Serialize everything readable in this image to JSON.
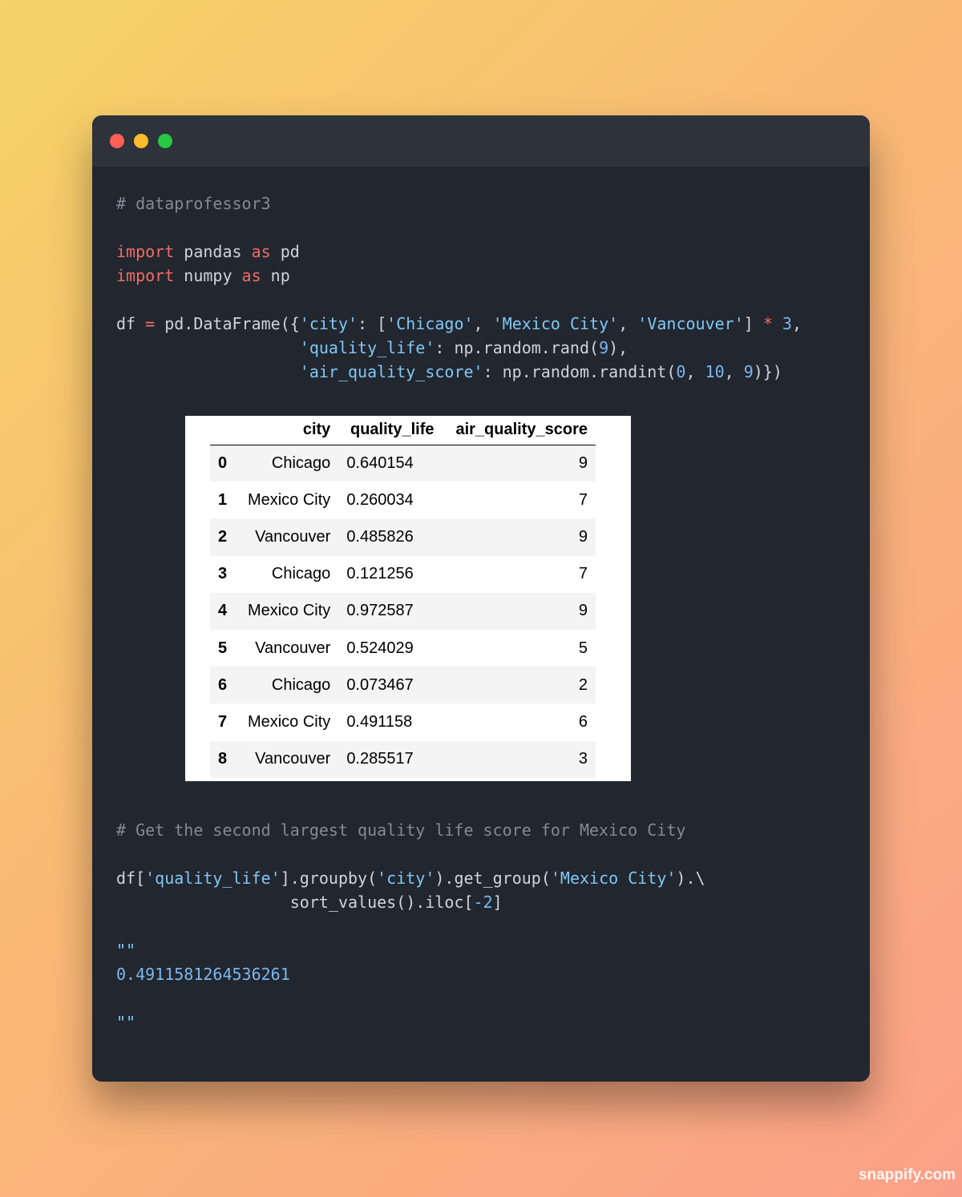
{
  "window": {
    "traffic_lights": [
      "close",
      "minimize",
      "maximize"
    ]
  },
  "code_lines": {
    "comment1": "# dataprofessor3",
    "import1": {
      "kw": "import",
      "mod": " pandas ",
      "as": "as",
      "alias": " pd"
    },
    "import2": {
      "kw": "import",
      "mod": " numpy ",
      "as": "as",
      "alias": " np"
    },
    "df_line1": {
      "a": "df ",
      "eq": "=",
      "b": " pd.DataFrame({",
      "s1": "'city'",
      "c": ": [",
      "s2": "'Chicago'",
      "d": ", ",
      "s3": "'Mexico City'",
      "e": ", ",
      "s4": "'Vancouver'",
      "f": "] ",
      "star": "*",
      "g": " ",
      "n3": "3",
      "h": ","
    },
    "df_line2": {
      "pad": "                   ",
      "s": "'quality_life'",
      "a": ": np.random.rand(",
      "n": "9",
      "b": "),"
    },
    "df_line3": {
      "pad": "                   ",
      "s": "'air_quality_score'",
      "a": ": np.random.randint(",
      "n0": "0",
      "c1": ", ",
      "n10": "10",
      "c2": ", ",
      "n9": "9",
      "b": ")})"
    },
    "comment2": "# Get the second largest quality life score for Mexico City",
    "query1": {
      "a": "df[",
      "s1": "'quality_life'",
      "b": "].groupby(",
      "s2": "'city'",
      "c": ").get_group(",
      "s3": "'Mexico City'",
      "d": ").\\"
    },
    "query2": {
      "pad": "                  ",
      "a": "sort_values().iloc[",
      "n": "-2",
      "b": "]"
    },
    "docstring_open": "\"\"",
    "output_value": "0.4911581264536261",
    "docstring_close": "\"\""
  },
  "dataframe": {
    "columns": [
      "",
      "city",
      "quality_life",
      "air_quality_score"
    ],
    "rows": [
      [
        "0",
        "Chicago",
        "0.640154",
        "9"
      ],
      [
        "1",
        "Mexico City",
        "0.260034",
        "7"
      ],
      [
        "2",
        "Vancouver",
        "0.485826",
        "9"
      ],
      [
        "3",
        "Chicago",
        "0.121256",
        "7"
      ],
      [
        "4",
        "Mexico City",
        "0.972587",
        "9"
      ],
      [
        "5",
        "Vancouver",
        "0.524029",
        "5"
      ],
      [
        "6",
        "Chicago",
        "0.073467",
        "2"
      ],
      [
        "7",
        "Mexico City",
        "0.491158",
        "6"
      ],
      [
        "8",
        "Vancouver",
        "0.285517",
        "3"
      ]
    ]
  },
  "watermark": "snappify.com",
  "colors": {
    "window_bg": "#22262f",
    "titlebar_bg": "#2d323b",
    "keyword": "#ef6d64",
    "string": "#7fc8f5",
    "comment": "#838a96"
  }
}
